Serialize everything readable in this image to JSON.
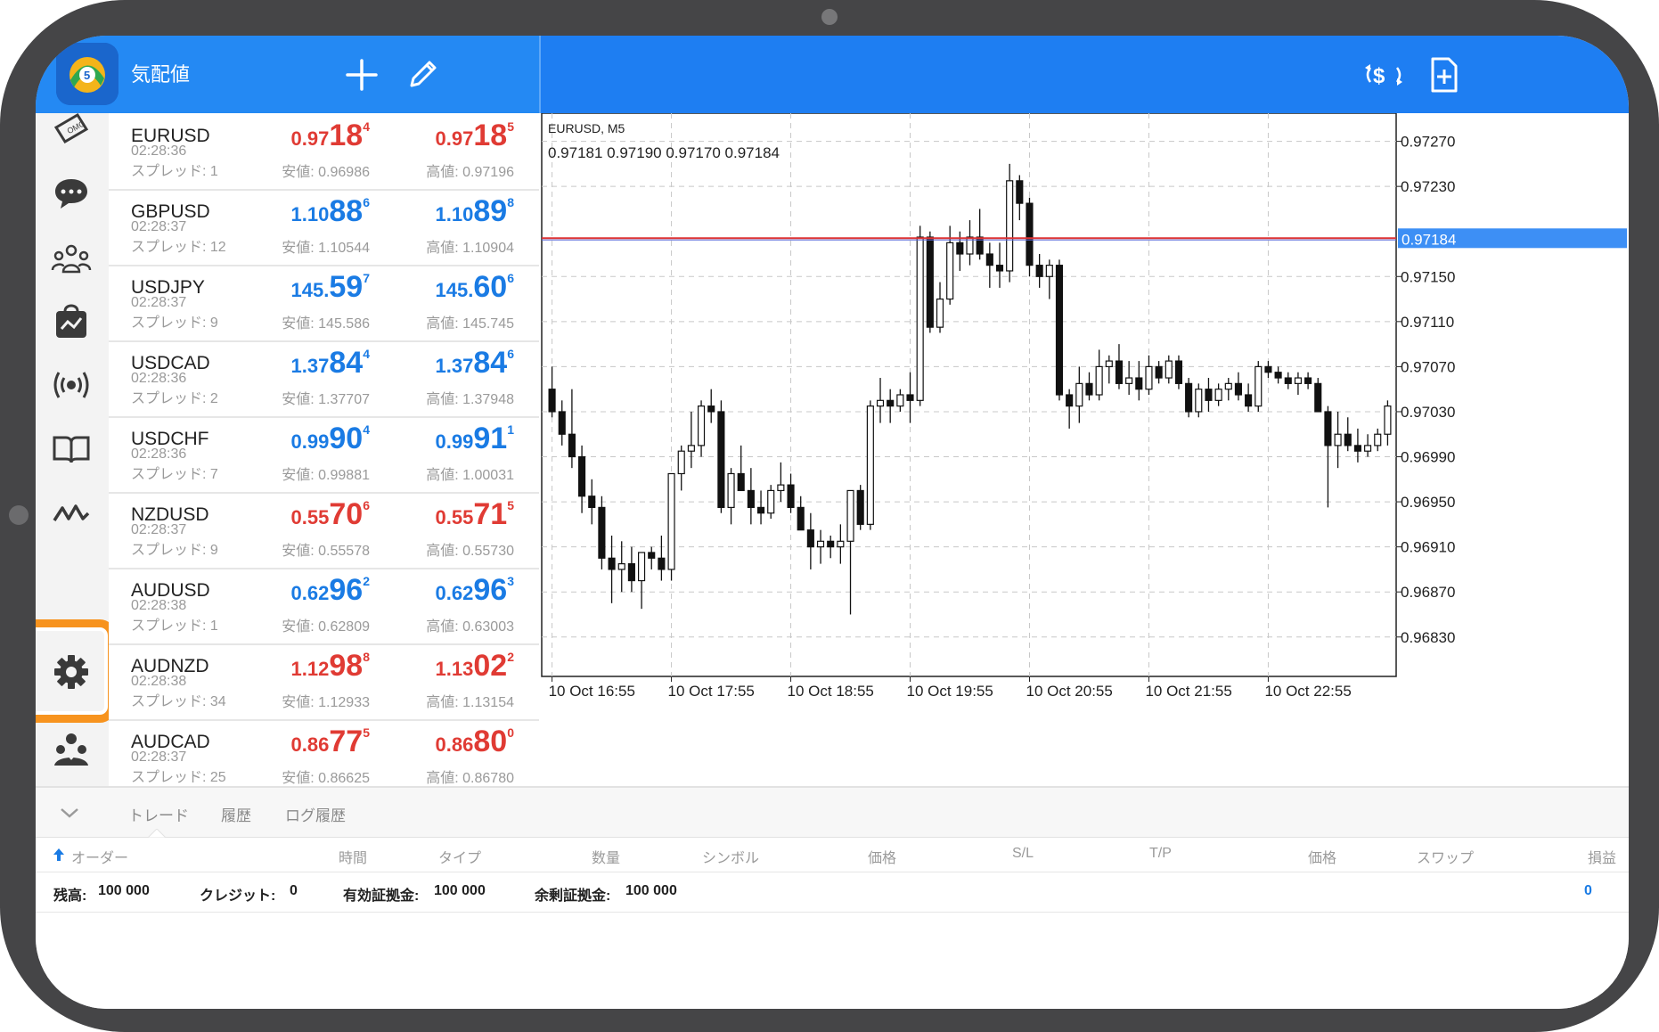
{
  "header": {
    "title": "気配値",
    "add_icon": "plus-icon",
    "edit_icon": "pencil-icon",
    "currency_icon": "currency-exchange-icon",
    "new_doc_icon": "new-document-icon"
  },
  "nav": [
    "news-icon",
    "chat-icon",
    "community-icon",
    "market-bag-icon",
    "signals-icon",
    "book-icon",
    "indicator-icon",
    "gear-icon",
    "traders-icon"
  ],
  "quotes": [
    {
      "symbol": "EURUSD",
      "time": "02:28:36",
      "spread": "スプレッド: 1",
      "color": "red",
      "bid": {
        "a": "0.97",
        "b": "18",
        "c": "4"
      },
      "ask": {
        "a": "0.97",
        "b": "18",
        "c": "5"
      },
      "low": "安値: 0.96986",
      "high": "高値: 0.97196"
    },
    {
      "symbol": "GBPUSD",
      "time": "02:28:37",
      "spread": "スプレッド: 12",
      "color": "blue",
      "bid": {
        "a": "1.10",
        "b": "88",
        "c": "6"
      },
      "ask": {
        "a": "1.10",
        "b": "89",
        "c": "8"
      },
      "low": "安値: 1.10544",
      "high": "高値: 1.10904"
    },
    {
      "symbol": "USDJPY",
      "time": "02:28:37",
      "spread": "スプレッド: 9",
      "color": "blue",
      "bid": {
        "a": "145.",
        "b": "59",
        "c": "7"
      },
      "ask": {
        "a": "145.",
        "b": "60",
        "c": "6"
      },
      "low": "安値: 145.586",
      "high": "高値: 145.745"
    },
    {
      "symbol": "USDCAD",
      "time": "02:28:36",
      "spread": "スプレッド: 2",
      "color": "blue",
      "bid": {
        "a": "1.37",
        "b": "84",
        "c": "4"
      },
      "ask": {
        "a": "1.37",
        "b": "84",
        "c": "6"
      },
      "low": "安値: 1.37707",
      "high": "高値: 1.37948"
    },
    {
      "symbol": "USDCHF",
      "time": "02:28:36",
      "spread": "スプレッド: 7",
      "color": "blue",
      "bid": {
        "a": "0.99",
        "b": "90",
        "c": "4"
      },
      "ask": {
        "a": "0.99",
        "b": "91",
        "c": "1"
      },
      "low": "安値: 0.99881",
      "high": "高値: 1.00031"
    },
    {
      "symbol": "NZDUSD",
      "time": "02:28:37",
      "spread": "スプレッド: 9",
      "color": "red",
      "bid": {
        "a": "0.55",
        "b": "70",
        "c": "6"
      },
      "ask": {
        "a": "0.55",
        "b": "71",
        "c": "5"
      },
      "low": "安値: 0.55578",
      "high": "高値: 0.55730"
    },
    {
      "symbol": "AUDUSD",
      "time": "02:28:38",
      "spread": "スプレッド: 1",
      "color": "blue",
      "bid": {
        "a": "0.62",
        "b": "96",
        "c": "2"
      },
      "ask": {
        "a": "0.62",
        "b": "96",
        "c": "3"
      },
      "low": "安値: 0.62809",
      "high": "高値: 0.63003"
    },
    {
      "symbol": "AUDNZD",
      "time": "02:28:38",
      "spread": "スプレッド: 34",
      "color": "red",
      "bid": {
        "a": "1.12",
        "b": "98",
        "c": "8"
      },
      "ask": {
        "a": "1.13",
        "b": "02",
        "c": "2"
      },
      "low": "安値: 1.12933",
      "high": "高値: 1.13154"
    },
    {
      "symbol": "AUDCAD",
      "time": "02:28:37",
      "spread": "スプレッド: 25",
      "color": "red",
      "bid": {
        "a": "0.86",
        "b": "77",
        "c": "5"
      },
      "ask": {
        "a": "0.86",
        "b": "80",
        "c": "0"
      },
      "low": "安値: 0.86625",
      "high": "高値: 0.86780"
    }
  ],
  "chart_data": {
    "type": "candlestick",
    "title": "EURUSD, M5",
    "ohlc_label": "0.97181 0.97190 0.97170 0.97184",
    "price_tag": "0.97184",
    "current_price": 0.97184,
    "ylim": [
      0.96795,
      0.97295
    ],
    "y_ticks": [
      "0.97270",
      "0.97230",
      "0.97150",
      "0.97110",
      "0.97070",
      "0.97030",
      "0.96990",
      "0.96950",
      "0.96910",
      "0.96870",
      "0.96830"
    ],
    "x_ticks": [
      "10 Oct 16:55",
      "10 Oct 17:55",
      "10 Oct 18:55",
      "10 Oct 19:55",
      "10 Oct 20:55",
      "10 Oct 21:55",
      "10 Oct 22:55"
    ],
    "candles": [
      [
        0.9705,
        0.9707,
        0.97025,
        0.9703
      ],
      [
        0.9703,
        0.9704,
        0.97,
        0.9701
      ],
      [
        0.9701,
        0.9705,
        0.9698,
        0.9699
      ],
      [
        0.9699,
        0.97,
        0.9694,
        0.96955
      ],
      [
        0.96955,
        0.9697,
        0.9693,
        0.96945
      ],
      [
        0.96945,
        0.96955,
        0.9689,
        0.969
      ],
      [
        0.969,
        0.9692,
        0.9686,
        0.9689
      ],
      [
        0.9689,
        0.96915,
        0.9687,
        0.96895
      ],
      [
        0.96895,
        0.9691,
        0.9687,
        0.9688
      ],
      [
        0.9688,
        0.96905,
        0.96855,
        0.96905
      ],
      [
        0.96905,
        0.9691,
        0.9689,
        0.969
      ],
      [
        0.969,
        0.9692,
        0.9688,
        0.9689
      ],
      [
        0.9689,
        0.96975,
        0.9688,
        0.96975
      ],
      [
        0.96975,
        0.97,
        0.9696,
        0.96995
      ],
      [
        0.96995,
        0.9703,
        0.9698,
        0.97
      ],
      [
        0.97,
        0.9704,
        0.9699,
        0.97035
      ],
      [
        0.97035,
        0.9705,
        0.9702,
        0.9703
      ],
      [
        0.9703,
        0.9704,
        0.9694,
        0.96945
      ],
      [
        0.96945,
        0.9698,
        0.9693,
        0.96975
      ],
      [
        0.96975,
        0.97,
        0.9696,
        0.9696
      ],
      [
        0.9696,
        0.9698,
        0.9693,
        0.96945
      ],
      [
        0.96945,
        0.9696,
        0.9693,
        0.9694
      ],
      [
        0.9694,
        0.96965,
        0.96935,
        0.9696
      ],
      [
        0.9696,
        0.96985,
        0.9695,
        0.96965
      ],
      [
        0.96965,
        0.96975,
        0.9694,
        0.96945
      ],
      [
        0.96945,
        0.96955,
        0.96925,
        0.96925
      ],
      [
        0.96925,
        0.9694,
        0.9689,
        0.9691
      ],
      [
        0.9691,
        0.96925,
        0.96895,
        0.96915
      ],
      [
        0.96915,
        0.9692,
        0.969,
        0.9691
      ],
      [
        0.9691,
        0.9693,
        0.96895,
        0.96915
      ],
      [
        0.96915,
        0.9694,
        0.9685,
        0.9696
      ],
      [
        0.9696,
        0.96965,
        0.96925,
        0.9693
      ],
      [
        0.9693,
        0.9704,
        0.96925,
        0.97035
      ],
      [
        0.97035,
        0.9706,
        0.9702,
        0.9704
      ],
      [
        0.9704,
        0.9705,
        0.9702,
        0.97035
      ],
      [
        0.97035,
        0.9705,
        0.9703,
        0.97045
      ],
      [
        0.97045,
        0.97065,
        0.9702,
        0.9704
      ],
      [
        0.9704,
        0.97195,
        0.97035,
        0.97185
      ],
      [
        0.97185,
        0.9719,
        0.971,
        0.97105
      ],
      [
        0.97105,
        0.97145,
        0.971,
        0.9713
      ],
      [
        0.9713,
        0.97195,
        0.97125,
        0.9718
      ],
      [
        0.9718,
        0.9719,
        0.97155,
        0.9717
      ],
      [
        0.9717,
        0.972,
        0.9716,
        0.97185
      ],
      [
        0.97185,
        0.9721,
        0.97165,
        0.9717
      ],
      [
        0.9717,
        0.9718,
        0.9714,
        0.9716
      ],
      [
        0.9716,
        0.9718,
        0.9714,
        0.97155
      ],
      [
        0.97155,
        0.9725,
        0.97145,
        0.97235
      ],
      [
        0.97235,
        0.9724,
        0.972,
        0.97215
      ],
      [
        0.97215,
        0.9722,
        0.9715,
        0.9716
      ],
      [
        0.9716,
        0.9717,
        0.9714,
        0.9715
      ],
      [
        0.9715,
        0.97165,
        0.9713,
        0.9716
      ],
      [
        0.9716,
        0.97165,
        0.9704,
        0.97045
      ],
      [
        0.97045,
        0.9705,
        0.97015,
        0.97035
      ],
      [
        0.97035,
        0.9707,
        0.9702,
        0.97055
      ],
      [
        0.97055,
        0.97065,
        0.9704,
        0.97045
      ],
      [
        0.97045,
        0.97085,
        0.9704,
        0.9707
      ],
      [
        0.9707,
        0.9708,
        0.97055,
        0.97075
      ],
      [
        0.97075,
        0.9709,
        0.9705,
        0.97055
      ],
      [
        0.97055,
        0.97075,
        0.97045,
        0.9706
      ],
      [
        0.9706,
        0.97075,
        0.9704,
        0.9705
      ],
      [
        0.9705,
        0.9708,
        0.97045,
        0.9707
      ],
      [
        0.9707,
        0.97075,
        0.97055,
        0.9706
      ],
      [
        0.9706,
        0.9708,
        0.97055,
        0.97075
      ],
      [
        0.97075,
        0.9708,
        0.9705,
        0.97055
      ],
      [
        0.97055,
        0.9706,
        0.97025,
        0.9703
      ],
      [
        0.9703,
        0.97055,
        0.97025,
        0.9705
      ],
      [
        0.9705,
        0.9706,
        0.9703,
        0.9704
      ],
      [
        0.9704,
        0.97055,
        0.97035,
        0.9705
      ],
      [
        0.9705,
        0.9706,
        0.9704,
        0.97055
      ],
      [
        0.97055,
        0.97065,
        0.9704,
        0.97045
      ],
      [
        0.97045,
        0.97055,
        0.9703,
        0.97035
      ],
      [
        0.97035,
        0.97075,
        0.9703,
        0.9707
      ],
      [
        0.9707,
        0.97075,
        0.9706,
        0.97065
      ],
      [
        0.97065,
        0.9707,
        0.97055,
        0.9706
      ],
      [
        0.9706,
        0.97065,
        0.9705,
        0.97055
      ],
      [
        0.97055,
        0.97065,
        0.97045,
        0.9706
      ],
      [
        0.9706,
        0.97065,
        0.9705,
        0.97055
      ],
      [
        0.97055,
        0.9706,
        0.9703,
        0.9703
      ],
      [
        0.9703,
        0.97035,
        0.96945,
        0.97
      ],
      [
        0.97,
        0.9703,
        0.9698,
        0.9701
      ],
      [
        0.9701,
        0.97025,
        0.96995,
        0.97
      ],
      [
        0.97,
        0.97015,
        0.96985,
        0.96995
      ],
      [
        0.96995,
        0.9701,
        0.9699,
        0.97
      ],
      [
        0.97,
        0.97015,
        0.96995,
        0.9701
      ],
      [
        0.9701,
        0.9704,
        0.97,
        0.97035
      ]
    ]
  },
  "bottom": {
    "tabs": [
      "トレード",
      "履歴",
      "ログ履歴"
    ],
    "columns": [
      "オーダー",
      "時間",
      "タイプ",
      "数量",
      "シンボル",
      "価格",
      "S/L",
      "T/P",
      "価格",
      "スワップ",
      "損益"
    ],
    "balance_label": "残高:",
    "balance": "100 000",
    "credit_label": "クレジット:",
    "credit": "0",
    "equity_label": "有効証拠金:",
    "equity": "100 000",
    "free_margin_label": "余剰証拠金:",
    "free_margin": "100 000",
    "profit": "0"
  }
}
